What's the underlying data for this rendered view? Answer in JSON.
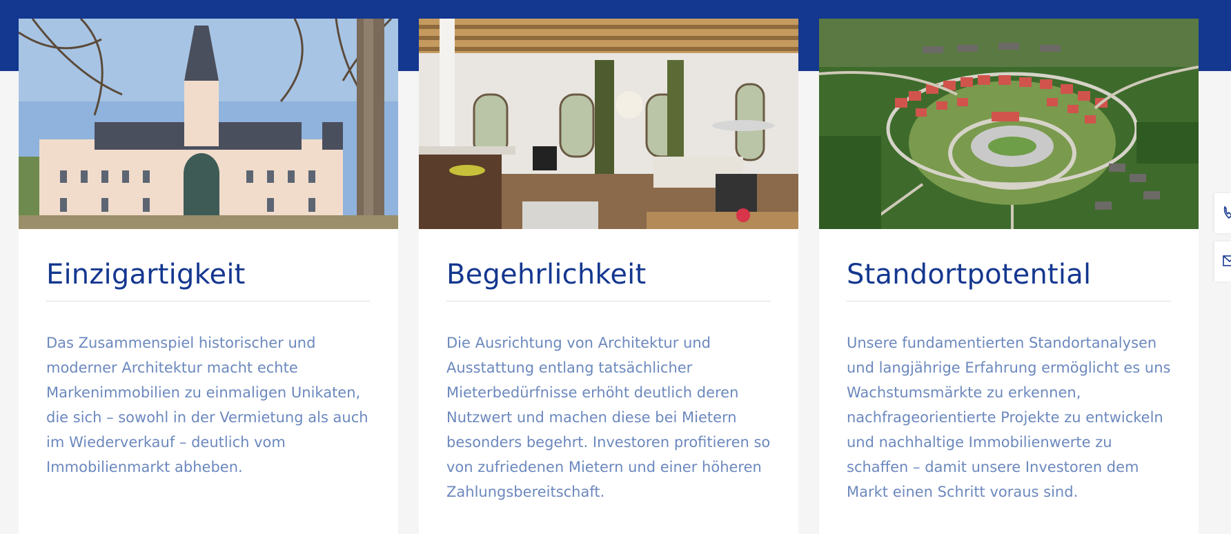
{
  "cards": [
    {
      "title": "Einzigartigkeit",
      "text": "Das Zusammenspiel historischer und moderner Architektur macht echte Markenimmobilien zu einmaligen Unikaten, die sich – sowohl in der Vermietung als auch im Wiederverkauf – deutlich vom Immobilienmarkt abheben."
    },
    {
      "title": "Begehrlichkeit",
      "text": "Die Ausrichtung von Architektur und Ausstattung entlang tatsächlicher Mieterbedürfnisse erhöht deutlich deren Nutzwert und machen diese bei Mietern besonders begehrt. Investoren profitieren so von zufriedenen Mietern und einer höheren Zahlungsbereitschaft."
    },
    {
      "title": "Standortpotential",
      "text": "Unsere fundamentierten Standortanalysen und langjährige Erfahrung ermöglicht es uns Wachstumsmärkte zu erkennen, nachfrageorientierte Projekte zu entwickeln und nachhaltige Immobilienwerte zu schaffen – damit unsere Investoren dem Markt einen Schritt voraus sind."
    }
  ],
  "side_buttons": [
    {
      "icon": "phone-icon"
    },
    {
      "icon": "mail-icon"
    }
  ],
  "colors": {
    "brand_blue": "#14378f",
    "text_blue": "#6b88bd",
    "background": "#f5f5f5"
  }
}
